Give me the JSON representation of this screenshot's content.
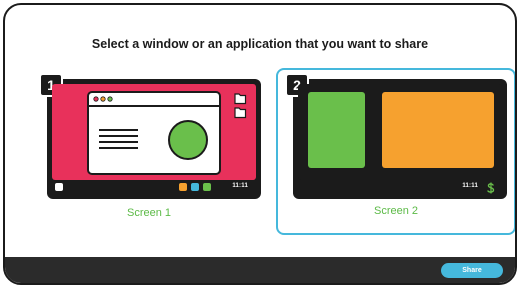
{
  "dialog": {
    "title": "Select a window or an application that you want to share",
    "share_label": "Share"
  },
  "options": [
    {
      "number": "1",
      "label": "Screen 1",
      "clock": "11:11",
      "selected": false
    },
    {
      "number": "2",
      "label": "Screen 2",
      "clock": "11:11",
      "selected": true
    }
  ],
  "colors": {
    "accent": "#45b8dc",
    "label_green": "#5cba47",
    "screen1_wallpaper": "#e8315b",
    "window_green": "#6abf4b",
    "window_orange": "#f6a12f",
    "frame": "#1b1b1b"
  },
  "icons": [
    "folder-icon",
    "dollar-icon"
  ]
}
